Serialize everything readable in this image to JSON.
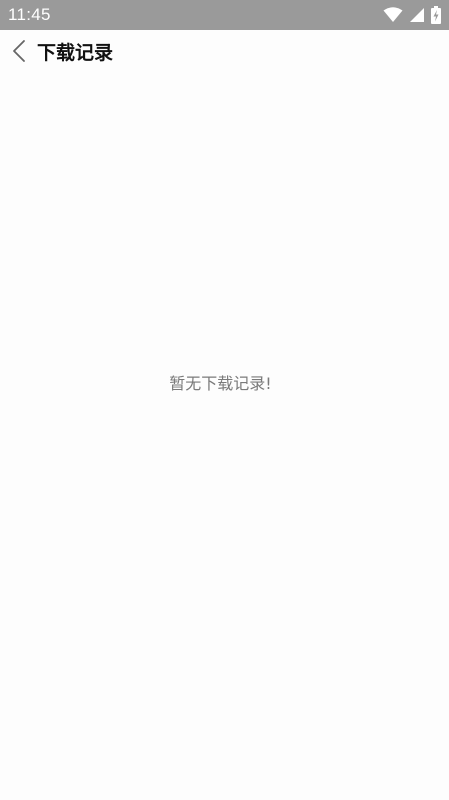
{
  "status_bar": {
    "time": "11:45",
    "icons": [
      "wifi-icon",
      "signal-icon",
      "battery-charging-icon"
    ],
    "background": "#9a9a9a"
  },
  "app_bar": {
    "back_icon": "chevron-left-icon",
    "title": "下载记录"
  },
  "content": {
    "empty_message": "暂无下载记录!"
  },
  "colors": {
    "page_background": "#fdfdfd",
    "title_text": "#111111",
    "empty_text": "#7a7a7a"
  }
}
